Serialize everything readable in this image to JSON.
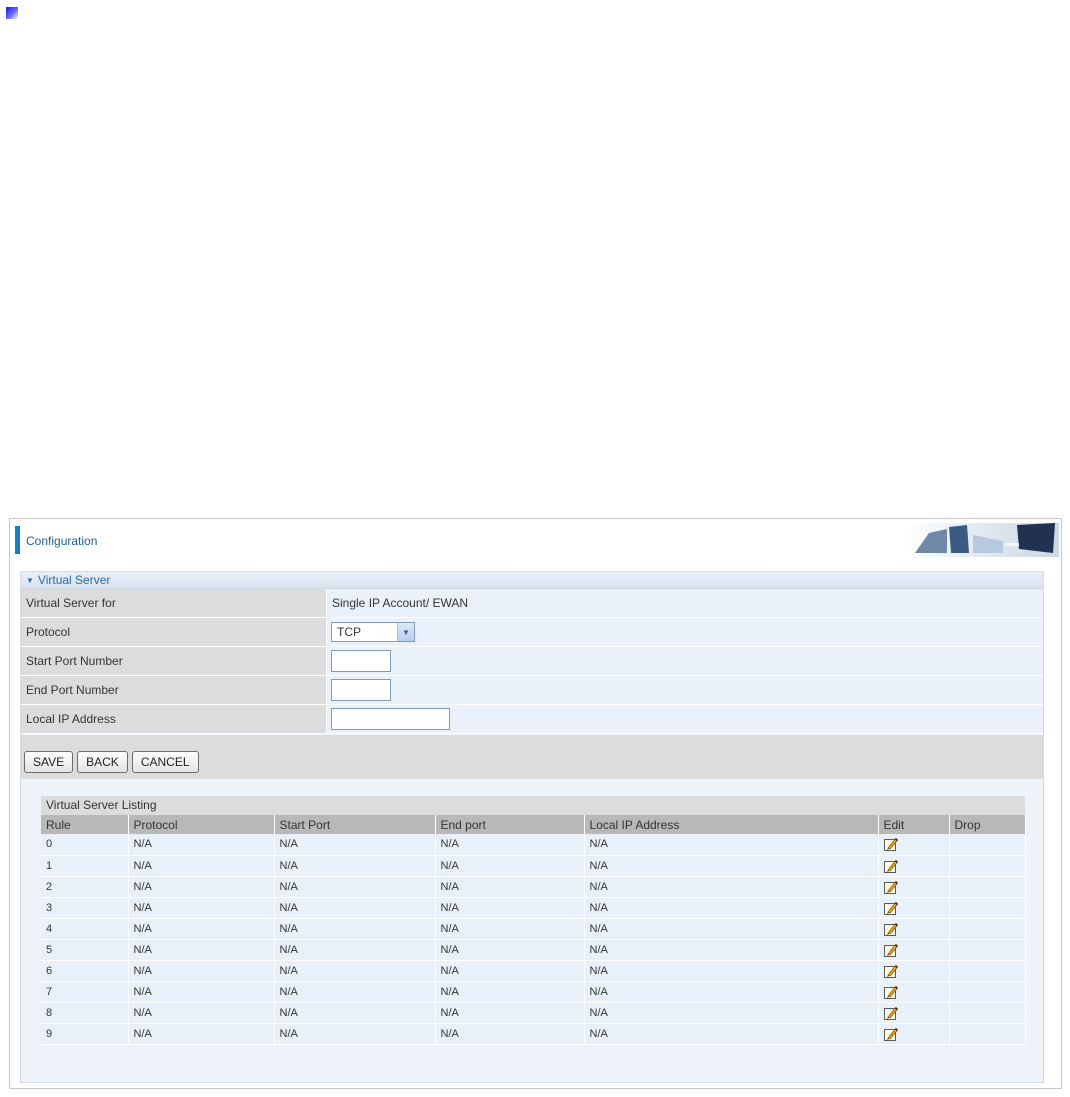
{
  "header": {
    "title": "Configuration"
  },
  "section": {
    "title": "Virtual Server"
  },
  "form": {
    "rows": [
      {
        "label": "Virtual Server for",
        "value": "Single IP Account/ EWAN"
      },
      {
        "label": "Protocol",
        "selected": "TCP"
      },
      {
        "label": "Start Port Number",
        "value": ""
      },
      {
        "label": "End Port Number",
        "value": ""
      },
      {
        "label": "Local IP Address",
        "value": ""
      }
    ]
  },
  "buttons": {
    "save": "SAVE",
    "back": "BACK",
    "cancel": "CANCEL"
  },
  "listing": {
    "title": "Virtual Server Listing",
    "columns": [
      "Rule",
      "Protocol",
      "Start Port",
      "End port",
      "Local IP Address",
      "Edit",
      "Drop"
    ],
    "rows": [
      {
        "rule": "0",
        "protocol": "N/A",
        "start": "N/A",
        "end": "N/A",
        "ip": "N/A"
      },
      {
        "rule": "1",
        "protocol": "N/A",
        "start": "N/A",
        "end": "N/A",
        "ip": "N/A"
      },
      {
        "rule": "2",
        "protocol": "N/A",
        "start": "N/A",
        "end": "N/A",
        "ip": "N/A"
      },
      {
        "rule": "3",
        "protocol": "N/A",
        "start": "N/A",
        "end": "N/A",
        "ip": "N/A"
      },
      {
        "rule": "4",
        "protocol": "N/A",
        "start": "N/A",
        "end": "N/A",
        "ip": "N/A"
      },
      {
        "rule": "5",
        "protocol": "N/A",
        "start": "N/A",
        "end": "N/A",
        "ip": "N/A"
      },
      {
        "rule": "6",
        "protocol": "N/A",
        "start": "N/A",
        "end": "N/A",
        "ip": "N/A"
      },
      {
        "rule": "7",
        "protocol": "N/A",
        "start": "N/A",
        "end": "N/A",
        "ip": "N/A"
      },
      {
        "rule": "8",
        "protocol": "N/A",
        "start": "N/A",
        "end": "N/A",
        "ip": "N/A"
      },
      {
        "rule": "9",
        "protocol": "N/A",
        "start": "N/A",
        "end": "N/A",
        "ip": "N/A"
      }
    ]
  },
  "colors": {
    "accent": "#1c7bc4",
    "header_text": "#1c5f9d",
    "row_bg": "#e8f0fa",
    "label_bg": "#dcdcdc"
  },
  "icons": {
    "corner": "corner-marker-icon",
    "edit": "edit-pencil-icon",
    "header": "header-banner-graphic"
  }
}
